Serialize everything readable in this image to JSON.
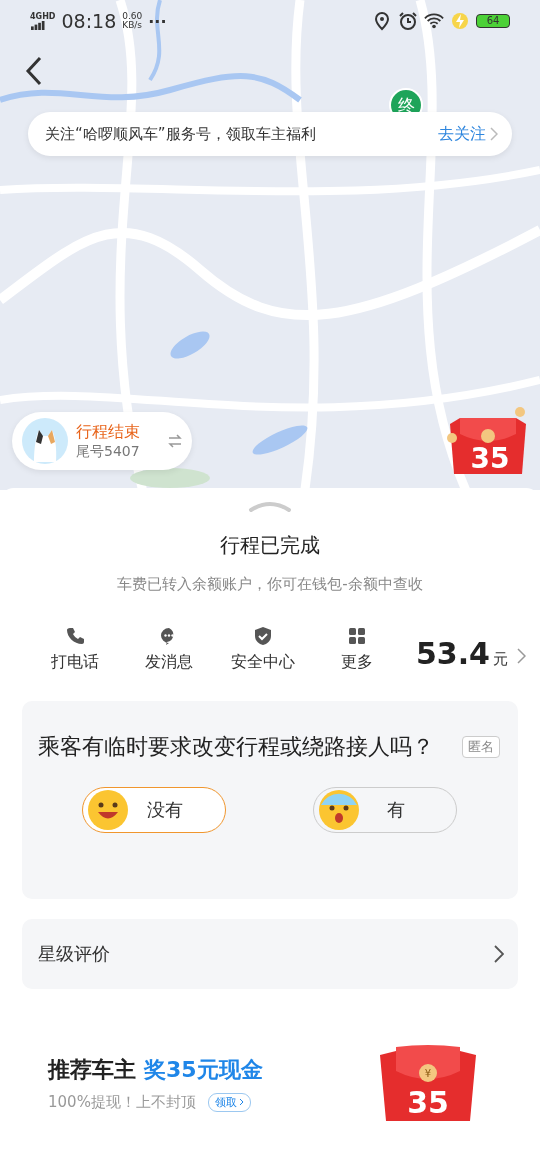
{
  "status_bar": {
    "network": "4GHD",
    "time": "08:18",
    "speed": "0.60",
    "speed_unit": "KB/s",
    "more": "···",
    "battery": "64"
  },
  "map": {
    "end_marker": "终"
  },
  "banner": {
    "text": "关注“哈啰顺风车”服务号，领取车主福利",
    "action": "去关注"
  },
  "driver_chip": {
    "status": "行程结束",
    "plate": "尾号5407"
  },
  "map_red_packet": {
    "amount": "35"
  },
  "trip": {
    "title": "行程已完成",
    "subtitle": "车费已转入余额账户，你可在钱包-余额中查收"
  },
  "actions": [
    {
      "kind": "phone",
      "label": "打电话"
    },
    {
      "kind": "message",
      "label": "发消息"
    },
    {
      "kind": "safety",
      "label": "安全中心"
    },
    {
      "kind": "more",
      "label": "更多"
    }
  ],
  "fare": {
    "amount": "53.4",
    "unit": "元"
  },
  "survey": {
    "question": "乘客有临时要求改变行程或绕路接人吗？",
    "tag": "匿名",
    "options": [
      {
        "kind": "happy",
        "label": "没有",
        "selected": true
      },
      {
        "kind": "sad",
        "label": "有",
        "selected": false
      }
    ]
  },
  "rating": {
    "label": "星级评价"
  },
  "promo": {
    "title": "推荐车主",
    "highlight": "奖35元现金",
    "subtitle": "100%提现！上不封顶",
    "action": "领取",
    "currency": "¥",
    "amount": "35"
  }
}
